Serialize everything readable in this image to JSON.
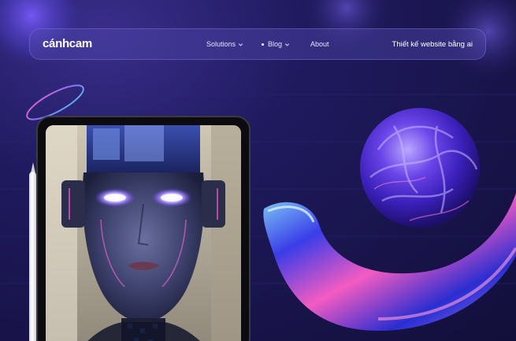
{
  "brand": {
    "logo_text": "cánhcam"
  },
  "nav": {
    "items": [
      {
        "label": "Solutions",
        "has_dropdown": true,
        "marker": false
      },
      {
        "label": "Blog",
        "has_dropdown": true,
        "marker": true
      },
      {
        "label": "About",
        "has_dropdown": false,
        "marker": false
      }
    ],
    "cta_label": "Thiết kế website bằng ai"
  },
  "colors": {
    "background": "#1a1650",
    "header_bg": "#4a40a8",
    "accent_blue": "#3b3ff0",
    "accent_pink": "#ff5fc8",
    "text": "#ffffff"
  },
  "icons": {
    "dropdown": "chevron-down-icon"
  }
}
